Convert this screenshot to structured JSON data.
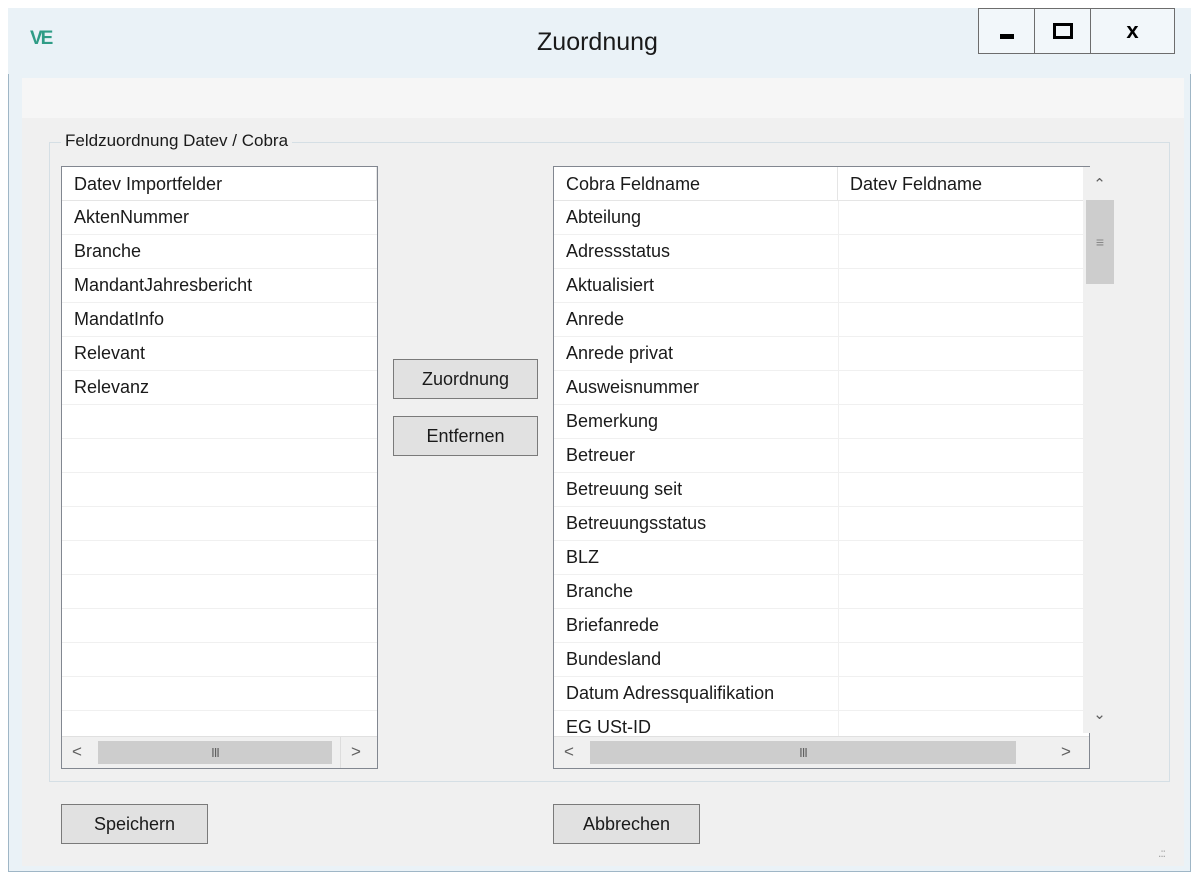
{
  "window": {
    "title": "Zuordnung",
    "app_icon_text": "VE",
    "app_icon_color": "#2f9c86",
    "close_label": "x"
  },
  "group": {
    "label": "Feldzuordnung Datev / Cobra"
  },
  "left_list": {
    "header": "Datev Importfelder",
    "items": [
      "AktenNummer",
      "Branche",
      "MandantJahresbericht",
      "MandatInfo",
      "Relevant",
      "Relevanz"
    ]
  },
  "right_list": {
    "headers": [
      "Cobra Feldname",
      "Datev Feldname"
    ],
    "rows": [
      {
        "cobra": "Abteilung",
        "datev": ""
      },
      {
        "cobra": "Adressstatus",
        "datev": ""
      },
      {
        "cobra": "Aktualisiert",
        "datev": ""
      },
      {
        "cobra": "Anrede",
        "datev": ""
      },
      {
        "cobra": "Anrede privat",
        "datev": ""
      },
      {
        "cobra": "Ausweisnummer",
        "datev": ""
      },
      {
        "cobra": "Bemerkung",
        "datev": ""
      },
      {
        "cobra": "Betreuer",
        "datev": ""
      },
      {
        "cobra": "Betreuung seit",
        "datev": ""
      },
      {
        "cobra": "Betreuungsstatus",
        "datev": ""
      },
      {
        "cobra": "BLZ",
        "datev": ""
      },
      {
        "cobra": "Branche",
        "datev": ""
      },
      {
        "cobra": "Briefanrede",
        "datev": ""
      },
      {
        "cobra": "Bundesland",
        "datev": ""
      },
      {
        "cobra": "Datum Adressqualifikation",
        "datev": ""
      },
      {
        "cobra": "EG USt-ID",
        "datev": ""
      }
    ]
  },
  "buttons": {
    "assign": "Zuordnung",
    "remove": "Entfernen",
    "save": "Speichern",
    "cancel": "Abbrechen"
  },
  "icons": {
    "scroll_left": "chevron-left-icon",
    "scroll_right": "chevron-right-icon",
    "scroll_up": "chevron-up-icon",
    "scroll_down": "chevron-down-icon",
    "thumb_grip": "grip-lines-icon"
  }
}
